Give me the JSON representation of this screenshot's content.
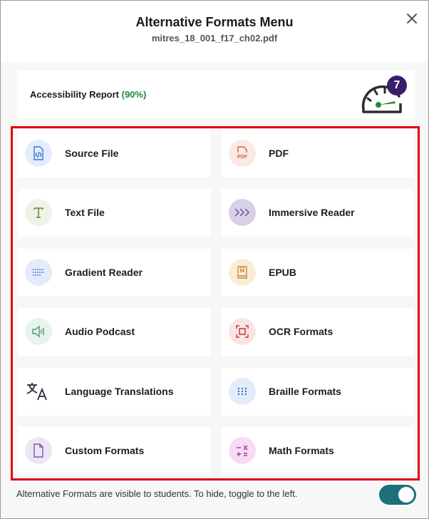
{
  "dialog": {
    "title": "Alternative Formats Menu",
    "filename": "mitres_18_001_f17_ch02.pdf"
  },
  "report": {
    "label": "Accessibility Report",
    "score": "(90%)",
    "badge": "7",
    "colors": {
      "score": "#1e8a3a",
      "badge": "#3b1e6b",
      "needle": "#1e8a3a"
    }
  },
  "formats": [
    {
      "label": "Source File",
      "icon": "code-file-icon"
    },
    {
      "label": "PDF",
      "icon": "pdf-file-icon"
    },
    {
      "label": "Text File",
      "icon": "text-t-icon"
    },
    {
      "label": "Immersive Reader",
      "icon": "chevrons-right-icon"
    },
    {
      "label": "Gradient Reader",
      "icon": "gradient-lines-icon"
    },
    {
      "label": "EPUB",
      "icon": "book-bookmark-icon"
    },
    {
      "label": "Audio Podcast",
      "icon": "speaker-icon"
    },
    {
      "label": "OCR Formats",
      "icon": "scan-frame-icon"
    },
    {
      "label": "Language Translations",
      "icon": "translate-icon"
    },
    {
      "label": "Braille Formats",
      "icon": "braille-dots-icon"
    },
    {
      "label": "Custom Formats",
      "icon": "blank-page-icon"
    },
    {
      "label": "Math Formats",
      "icon": "math-symbols-icon"
    }
  ],
  "footer": {
    "text": "Alternative Formats are visible to students. To hide, toggle to the left.",
    "toggle_on": true,
    "toggle_color": "#1e6f7a"
  }
}
